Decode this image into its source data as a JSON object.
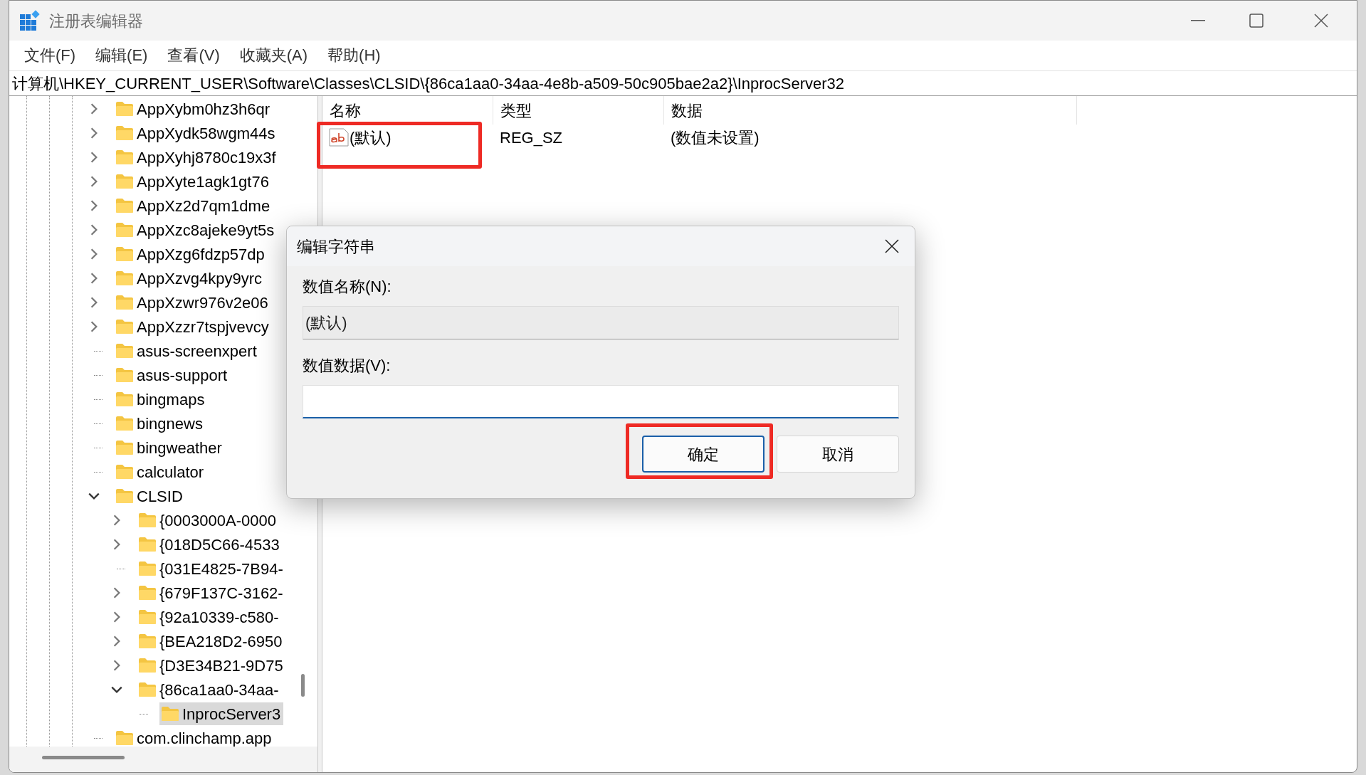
{
  "window": {
    "title": "注册表编辑器"
  },
  "menu": [
    "文件(F)",
    "编辑(E)",
    "查看(V)",
    "收藏夹(A)",
    "帮助(H)"
  ],
  "address_bar": "计算机\\HKEY_CURRENT_USER\\Software\\Classes\\CLSID\\{86ca1aa0-34aa-4e8b-a509-50c905bae2a2}\\InprocServer32",
  "tree": [
    {
      "label": "AppXybm0hz3h6qr",
      "kind": "branch",
      "expanded": false,
      "selected": false
    },
    {
      "label": "AppXydk58wgm44s",
      "kind": "branch",
      "expanded": false,
      "selected": false
    },
    {
      "label": "AppXyhj8780c19x3f",
      "kind": "branch",
      "expanded": false,
      "selected": false
    },
    {
      "label": "AppXyte1agk1gt76",
      "kind": "branch",
      "expanded": false,
      "selected": false
    },
    {
      "label": "AppXz2d7qm1dme",
      "kind": "branch",
      "expanded": false,
      "selected": false
    },
    {
      "label": "AppXzc8ajeke9yt5s",
      "kind": "branch",
      "expanded": false,
      "selected": false
    },
    {
      "label": "AppXzg6fdzp57dp",
      "kind": "branch",
      "expanded": false,
      "selected": false
    },
    {
      "label": "AppXzvg4kpy9yrc",
      "kind": "branch",
      "expanded": false,
      "selected": false
    },
    {
      "label": "AppXzwr976v2e06",
      "kind": "branch",
      "expanded": false,
      "selected": false
    },
    {
      "label": "AppXzzr7tspjvevcy",
      "kind": "branch",
      "expanded": false,
      "selected": false
    },
    {
      "label": "asus-screenxpert",
      "kind": "leaf",
      "selected": false
    },
    {
      "label": "asus-support",
      "kind": "leaf",
      "selected": false
    },
    {
      "label": "bingmaps",
      "kind": "leaf",
      "selected": false
    },
    {
      "label": "bingnews",
      "kind": "leaf",
      "selected": false
    },
    {
      "label": "bingweather",
      "kind": "leaf",
      "selected": false
    },
    {
      "label": "calculator",
      "kind": "leaf",
      "selected": false
    },
    {
      "label": "CLSID",
      "kind": "branch",
      "expanded": true,
      "selected": false,
      "children": [
        {
          "label": "{0003000A-0000",
          "kind": "branch",
          "expanded": false,
          "selected": false
        },
        {
          "label": "{018D5C66-4533",
          "kind": "branch",
          "expanded": false,
          "selected": false
        },
        {
          "label": "{031E4825-7B94-",
          "kind": "leaf",
          "selected": false
        },
        {
          "label": "{679F137C-3162-",
          "kind": "branch",
          "expanded": false,
          "selected": false
        },
        {
          "label": "{92a10339-c580-",
          "kind": "branch",
          "expanded": false,
          "selected": false
        },
        {
          "label": "{BEA218D2-6950",
          "kind": "branch",
          "expanded": false,
          "selected": false
        },
        {
          "label": "{D3E34B21-9D75",
          "kind": "branch",
          "expanded": false,
          "selected": false
        },
        {
          "label": "{86ca1aa0-34aa-",
          "kind": "branch",
          "expanded": true,
          "selected": false,
          "children": [
            {
              "label": "InprocServer3",
              "kind": "leaf",
              "selected": true
            }
          ]
        }
      ]
    },
    {
      "label": "com.clinchamp.app",
      "kind": "leaf",
      "selected": false
    }
  ],
  "values_list": {
    "columns": [
      "名称",
      "类型",
      "数据"
    ],
    "rows": [
      {
        "name": "(默认)",
        "type": "REG_SZ",
        "data": "(数值未设置)",
        "kind": "string",
        "highlighted": true
      }
    ]
  },
  "dialog": {
    "title": "编辑字符串",
    "name_label": "数值名称(N):",
    "name_value": "(默认)",
    "data_label": "数值数据(V):",
    "buttons": [
      {
        "label": "确定",
        "focused": true,
        "highlighted": true
      },
      {
        "label": "取消",
        "focused": false,
        "highlighted": false
      }
    ]
  }
}
